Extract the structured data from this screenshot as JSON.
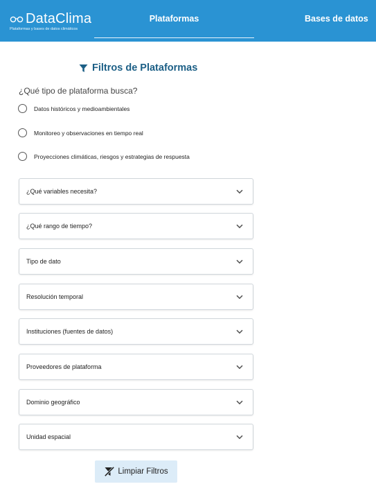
{
  "header": {
    "logo_title": "DataClima",
    "logo_subtitle": "Plataformas y bases de datos climáticos",
    "tabs": [
      {
        "label": "Plataformas",
        "active": true
      },
      {
        "label": "Bases de datos",
        "active": false
      }
    ],
    "bar_color": "#2a93d3"
  },
  "filters": {
    "title": "Filtros de Plataformas",
    "title_icon": "filter-icon",
    "platform_question": "¿Qué tipo de plataforma busca?",
    "platform_options": [
      {
        "label": "Datos históricos y medioambientales",
        "selected": false
      },
      {
        "label": "Monitoreo y observaciones en tiempo real",
        "selected": false
      },
      {
        "label": "Proyecciones climáticas, riesgos y estrategias de respuesta",
        "selected": false
      }
    ],
    "accordions": [
      {
        "label": "¿Qué variables necesita?"
      },
      {
        "label": "¿Qué rango de tiempo?"
      },
      {
        "label": "Tipo de dato"
      },
      {
        "label": "Resolución temporal"
      },
      {
        "label": "Instituciones (fuentes de datos)"
      },
      {
        "label": "Proveedores de plataforma"
      },
      {
        "label": "Dominio geográfico"
      },
      {
        "label": "Unidad espacial"
      }
    ],
    "clear_button": {
      "label": "Limpiar Filtros",
      "icon": "filter-off-icon"
    }
  }
}
